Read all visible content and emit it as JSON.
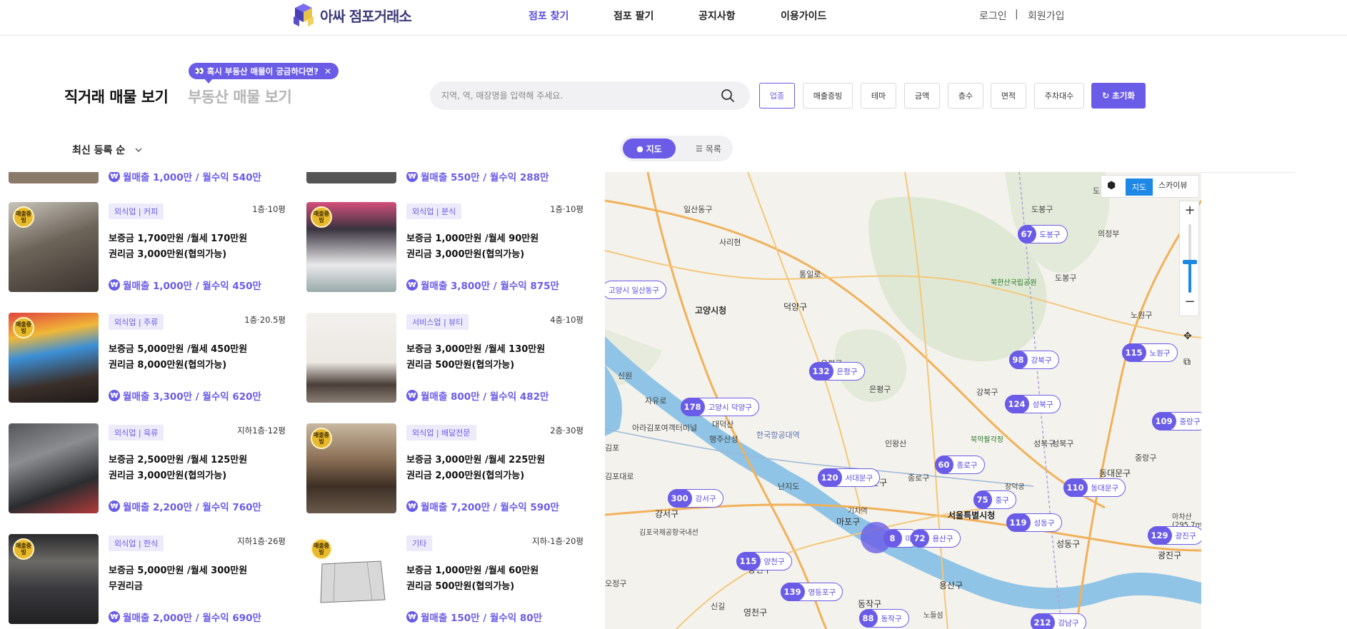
{
  "header": {
    "logo_text": "아싸 점포거래소",
    "nav": [
      "점포 찾기",
      "점포 팔기",
      "공지사항",
      "이용가이드"
    ],
    "login": "로그인",
    "separator": "|",
    "signup": "회원가입"
  },
  "tabs": {
    "main": "직거래 매물 보기",
    "sub": "부동산 매물 보기",
    "tooltip": "혹시 부동산 매물이 궁금하다면?"
  },
  "search": {
    "placeholder": "지역, 역, 매장명을 입력해 주세요."
  },
  "filters": [
    "업종",
    "매출증빙",
    "테마",
    "금액",
    "층수",
    "면적",
    "주차대수"
  ],
  "reset_label": "초기화",
  "sort": {
    "label": "최신 등록 순"
  },
  "view_toggle": {
    "map": "지도",
    "list": "목록"
  },
  "badge_text": "매출증빙",
  "partial_top": [
    {
      "sales": "월매출 1,000만 / 월수익 540만"
    },
    {
      "sales": "월매출 550만 / 월수익 288만"
    }
  ],
  "listings": [
    {
      "category": "외식업 | 커피",
      "floor": "1층·10평",
      "price1": "보증금 1,700만원 /월세 170만원",
      "price2": "권리금 3,000만원(협의가능)",
      "sales": "월매출 1,000만 / 월수익 450만",
      "badge": true
    },
    {
      "category": "외식업 | 분식",
      "floor": "1층·10평",
      "price1": "보증금 1,000만원 /월세 90만원",
      "price2": "권리금 3,000만원(협의가능)",
      "sales": "월매출 3,800만 / 월수익 875만",
      "badge": true
    },
    {
      "category": "외식업 | 주류",
      "floor": "1층·20.5평",
      "price1": "보증금 5,000만원 /월세 450만원",
      "price2": "권리금 8,000만원(협의가능)",
      "sales": "월매출 3,300만 / 월수익 620만",
      "badge": true
    },
    {
      "category": "서비스업 | 뷰티",
      "floor": "4층·10평",
      "price1": "보증금 3,000만원 /월세 130만원",
      "price2": "권리금 500만원(협의가능)",
      "sales": "월매출 800만 / 월수익 482만",
      "badge": false
    },
    {
      "category": "외식업 | 육류",
      "floor": "지하1층·12평",
      "price1": "보증금 2,500만원 /월세 125만원",
      "price2": "권리금 3,000만원(협의가능)",
      "sales": "월매출 2,200만 / 월수익 760만",
      "badge": false
    },
    {
      "category": "외식업 | 배달전문",
      "floor": "2층·30평",
      "price1": "보증금 3,000만원 /월세 225만원",
      "price2": "권리금 2,000만원(협의가능)",
      "sales": "월매출 7,200만 / 월수익 590만",
      "badge": true
    },
    {
      "category": "외식업 | 한식",
      "floor": "지하1층·26평",
      "price1": "보증금 5,000만원 /월세 300만원",
      "price2": "무권리금",
      "sales": "월매출 2,000만 / 월수익 690만",
      "badge": true
    },
    {
      "category": "기타",
      "floor": "지하-1층·20평",
      "price1": "보증금 1,000만원 /월세 60만원",
      "price2": "권리금 500만원(협의가능)",
      "sales": "월매출 150만 / 월수익 80만",
      "badge": true
    }
  ],
  "map": {
    "type_map": "지도",
    "type_sky": "스카이뷰",
    "zoom_in": "+",
    "zoom_out": "−",
    "zoom_level": 0.45,
    "clusters": [
      {
        "count": "67",
        "name": "도봉구"
      },
      {
        "count": "",
        "name": "고양시 일산동구"
      },
      {
        "count": "98",
        "name": "강북구"
      },
      {
        "count": "115",
        "name": "노원구"
      },
      {
        "count": "132",
        "name": "은평구"
      },
      {
        "count": "124",
        "name": "성북구"
      },
      {
        "count": "178",
        "name": "고양시 덕양구"
      },
      {
        "count": "109",
        "name": "중랑구"
      },
      {
        "count": "60",
        "name": "종로구"
      },
      {
        "count": "120",
        "name": "서대문구"
      },
      {
        "count": "75",
        "name": "중구"
      },
      {
        "count": "110",
        "name": "동대문구"
      },
      {
        "count": "300",
        "name": "강서구"
      },
      {
        "count": "119",
        "name": "성동구"
      },
      {
        "count": "8",
        "name": "마"
      },
      {
        "count": "72",
        "name": "용산구"
      },
      {
        "count": "129",
        "name": "광진구"
      },
      {
        "count": "115",
        "name": "양천구"
      },
      {
        "count": "139",
        "name": "영등포구"
      },
      {
        "count": "88",
        "name": "동작구"
      },
      {
        "count": "212",
        "name": "강남구"
      }
    ],
    "place_labels": [
      "일산동구",
      "사리현",
      "통일로",
      "도봉구",
      "도봉",
      "의정부",
      "고양시청",
      "덕양구",
      "북한산국립공원",
      "도봉구",
      "노원구",
      "은평구",
      "은평구",
      "강북구",
      "성북구",
      "신원",
      "자유로",
      "대덕산",
      "한국항공대역",
      "북악팔각정",
      "성북구",
      "아라김포여객터미널",
      "김포",
      "행주산성",
      "인왕산",
      "대문구",
      "동대문구",
      "김포대로",
      "난지도",
      "서대문구",
      "종로구",
      "창덕궁",
      "중랑구",
      "서울특별시청",
      "마포구",
      "기차역",
      "김포국제공항국내선",
      "성동구",
      "광진구",
      "강서구",
      "양천구",
      "신길",
      "용산구",
      "영천구",
      "노들섬",
      "오정구",
      "동작구",
      "아차산(295.7m)"
    ]
  }
}
